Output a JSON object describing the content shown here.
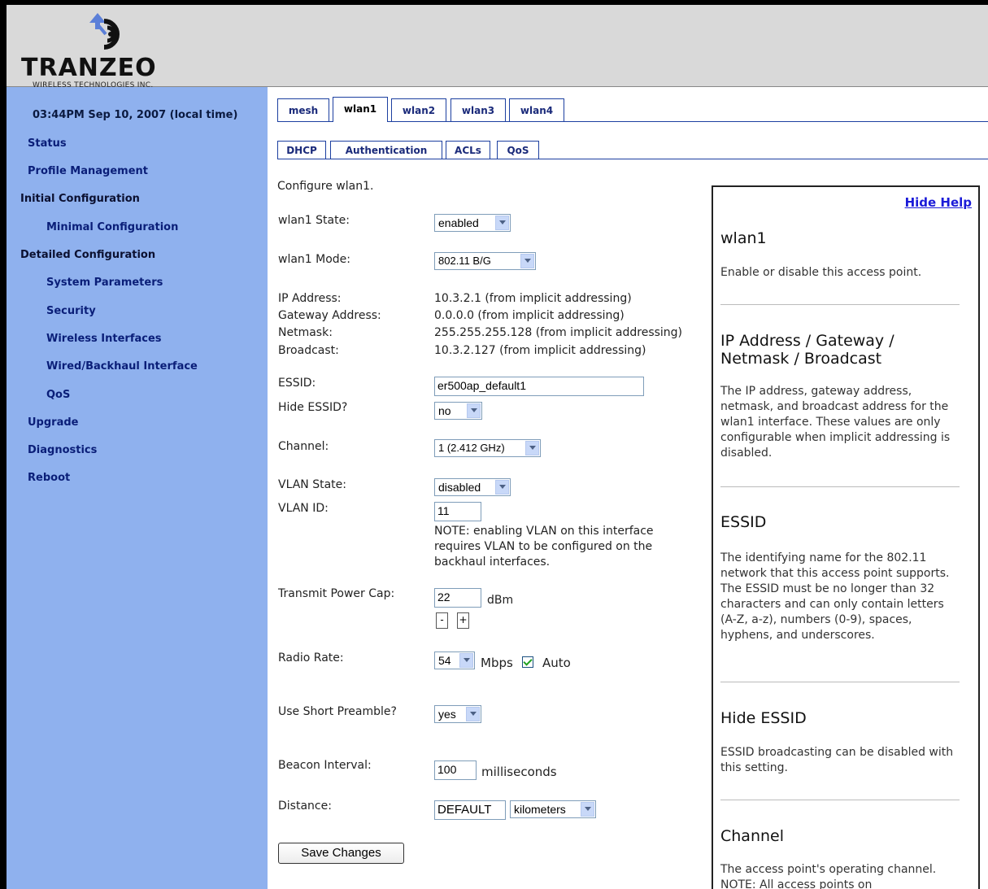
{
  "brand": {
    "name": "TRANZEO",
    "subtitle": "WIRELESS TECHNOLOGIES INC."
  },
  "sidebar": {
    "datetime": "03:44PM Sep 10, 2007 (local time)",
    "items": [
      {
        "label": "Status"
      },
      {
        "label": "Profile Management"
      },
      {
        "label": "Initial Configuration"
      },
      {
        "label": "Minimal Configuration"
      },
      {
        "label": "Detailed Configuration"
      },
      {
        "label": "System Parameters"
      },
      {
        "label": "Security"
      },
      {
        "label": "Wireless Interfaces"
      },
      {
        "label": "Wired/Backhaul Interface"
      },
      {
        "label": "QoS"
      },
      {
        "label": "Upgrade"
      },
      {
        "label": "Diagnostics"
      },
      {
        "label": "Reboot"
      }
    ]
  },
  "tabs": [
    {
      "label": "mesh"
    },
    {
      "label": "wlan1",
      "active": true
    },
    {
      "label": "wlan2"
    },
    {
      "label": "wlan3"
    },
    {
      "label": "wlan4"
    }
  ],
  "subtabs": [
    {
      "label": "DHCP"
    },
    {
      "label": "Authentication"
    },
    {
      "label": "ACLs"
    },
    {
      "label": "QoS"
    }
  ],
  "form": {
    "intro": "Configure wlan1.",
    "state": {
      "label": "wlan1 State:",
      "value": "enabled"
    },
    "mode": {
      "label": "wlan1 Mode:",
      "value": "802.11 B/G"
    },
    "ip": {
      "label": "IP Address:",
      "value": "10.3.2.1 (from implicit addressing)"
    },
    "gateway": {
      "label": "Gateway Address:",
      "value": "0.0.0.0 (from implicit addressing)"
    },
    "netmask": {
      "label": "Netmask:",
      "value": "255.255.255.128 (from implicit addressing)"
    },
    "broadcast": {
      "label": "Broadcast:",
      "value": "10.3.2.127 (from implicit addressing)"
    },
    "essid": {
      "label": "ESSID:",
      "value": "er500ap_default1"
    },
    "hide_essid": {
      "label": "Hide ESSID?",
      "value": "no"
    },
    "channel": {
      "label": "Channel:",
      "value": "1 (2.412 GHz)"
    },
    "vlan_state": {
      "label": "VLAN State:",
      "value": "disabled"
    },
    "vlan_id": {
      "label": "VLAN ID:",
      "value": "11"
    },
    "vlan_note": [
      "NOTE: enabling VLAN on this interface",
      "requires VLAN to be configured on the",
      "backhaul interfaces."
    ],
    "tx_power": {
      "label": "Transmit Power Cap:",
      "value": "22",
      "unit": "dBm",
      "minus": "-",
      "plus": "+"
    },
    "radio_rate": {
      "label": "Radio Rate:",
      "value": "54",
      "unit": "Mbps",
      "auto_label": "Auto",
      "auto_checked": true
    },
    "short_preamble": {
      "label": "Use Short Preamble?",
      "value": "yes"
    },
    "beacon": {
      "label": "Beacon Interval:",
      "value": "100",
      "unit": "milliseconds"
    },
    "distance": {
      "label": "Distance:",
      "value": "DEFAULT",
      "unit": "kilometers"
    },
    "save_label": "Save Changes"
  },
  "help": {
    "hide_label": "Hide Help",
    "sections": [
      {
        "title": "wlan1",
        "body": "Enable or disable this access point."
      },
      {
        "title": "IP Address / Gateway / Netmask / Broadcast",
        "body": "The IP address, gateway address, netmask, and broadcast address for the wlan1 interface. These values are only configurable when implicit addressing is disabled."
      },
      {
        "title": "ESSID",
        "body": "The identifying name for the 802.11 network that this access point supports. The ESSID must be no longer than 32 characters and can only contain letters (A-Z, a-z), numbers (0-9), spaces, hyphens, and underscores."
      },
      {
        "title": "Hide ESSID",
        "body": "ESSID broadcasting can be disabled with this setting."
      },
      {
        "title": "Channel",
        "body": "The access point's operating channel. NOTE: All access points on"
      }
    ]
  }
}
